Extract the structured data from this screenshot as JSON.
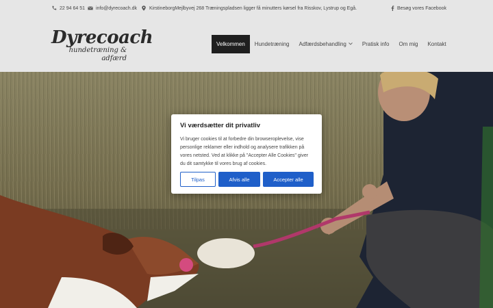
{
  "topbar": {
    "phone": "22 94 64 51",
    "email": "info@dyrecoach.dk",
    "address": "KirstineborgMejlbyvej 268 Træningspladsen ligger få minutters kørsel fra Risskov, Lystrup og Egå.",
    "facebook": "Besøg vores Facebook"
  },
  "logo": {
    "main": "Dyrecoach",
    "sub1": "hundetræning &",
    "sub2": "adfærd"
  },
  "nav": [
    {
      "label": "Velkommen",
      "active": true
    },
    {
      "label": "Hundetræning",
      "active": false
    },
    {
      "label": "Adfærdsbehandling",
      "active": false,
      "has_dropdown": true
    },
    {
      "label": "Pratisk info",
      "active": false
    },
    {
      "label": "Om mig",
      "active": false
    },
    {
      "label": "Kontakt",
      "active": false
    }
  ],
  "cookie": {
    "title": "Vi værdsætter dit privatliv",
    "text": "Vi bruger cookies til at forbedre din browseroplevelse, vise personlige reklamer eller indhold og analysere trafikken på vores netsted. Ved at klikke på \"Accepter Alle Cookies\" giver du dit samtykke til vores brug af cookies.",
    "customize_label": "Tilpas",
    "reject_label": "Afvis alle",
    "accept_label": "Accepter alle"
  },
  "colors": {
    "accent": "#1f5fc9",
    "nav_active_bg": "#1f1f1f",
    "topbar_bg": "#e6e6e6"
  },
  "icons": {
    "phone": "phone-icon",
    "email": "envelope-icon",
    "address": "map-pin-icon",
    "facebook": "facebook-icon",
    "dropdown": "chevron-down-icon"
  }
}
